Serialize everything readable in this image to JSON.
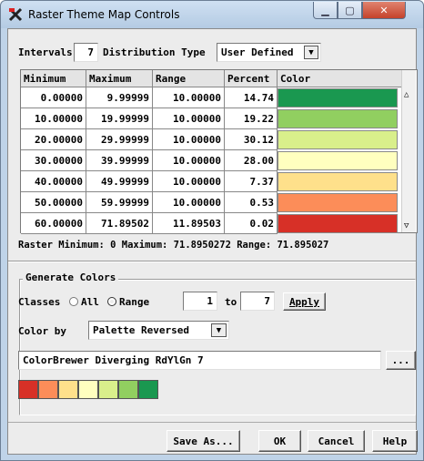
{
  "window": {
    "title": "Raster Theme Map Controls"
  },
  "intervals": {
    "label": "Intervals",
    "value": "7"
  },
  "distribution": {
    "label": "Distribution Type",
    "value": "User Defined"
  },
  "table": {
    "headers": [
      "Minimum",
      "Maximum",
      "Range",
      "Percent",
      "Color"
    ],
    "rows": [
      {
        "min": "0.00000",
        "max": "9.99999",
        "range": "10.00000",
        "percent": "14.74",
        "color": "#1a9850"
      },
      {
        "min": "10.00000",
        "max": "19.99999",
        "range": "10.00000",
        "percent": "19.22",
        "color": "#91cf60"
      },
      {
        "min": "20.00000",
        "max": "29.99999",
        "range": "10.00000",
        "percent": "30.12",
        "color": "#d9ef8b"
      },
      {
        "min": "30.00000",
        "max": "39.99999",
        "range": "10.00000",
        "percent": "28.00",
        "color": "#ffffbf"
      },
      {
        "min": "40.00000",
        "max": "49.99999",
        "range": "10.00000",
        "percent": "7.37",
        "color": "#fee08b"
      },
      {
        "min": "50.00000",
        "max": "59.99999",
        "range": "10.00000",
        "percent": "0.53",
        "color": "#fc8d59"
      },
      {
        "min": "60.00000",
        "max": "71.89502",
        "range": "11.89503",
        "percent": "0.02",
        "color": "#d73027"
      }
    ]
  },
  "raster_info": "Raster Minimum: 0  Maximum: 71.8950272  Range: 71.895027",
  "generate": {
    "title": "Generate Colors",
    "classes_label": "Classes",
    "all_label": "All",
    "range_label": "Range",
    "from_value": "1",
    "to_label": "to",
    "to_value": "7",
    "apply_label": "Apply",
    "color_by_label": "Color by",
    "color_by_value": "Palette Reversed",
    "palette_name": "ColorBrewer Diverging RdYlGn 7",
    "browse_label": "...",
    "palette_colors": [
      "#d73027",
      "#fc8d59",
      "#fee08b",
      "#ffffbf",
      "#d9ef8b",
      "#91cf60",
      "#1a9850"
    ]
  },
  "buttons": {
    "save_as": "Save As...",
    "ok": "OK",
    "cancel": "Cancel",
    "help": "Help"
  }
}
